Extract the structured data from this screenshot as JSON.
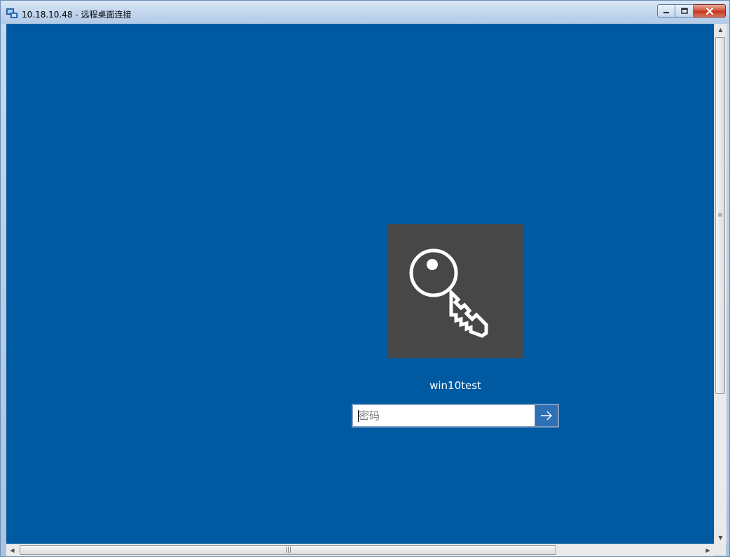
{
  "window": {
    "title": "10.18.10.48 - 远程桌面连接",
    "buttons": {
      "minimize": "minimize",
      "maximize": "maximize",
      "close": "close"
    }
  },
  "login": {
    "username": "win10test",
    "password_placeholder": "密码",
    "password_value": "",
    "submit_icon": "arrow-right-icon",
    "avatar_icon": "key-icon"
  },
  "colors": {
    "desktop_background": "#005aa1",
    "avatar_background": "#474747",
    "submit_background": "#2f6fb5"
  }
}
